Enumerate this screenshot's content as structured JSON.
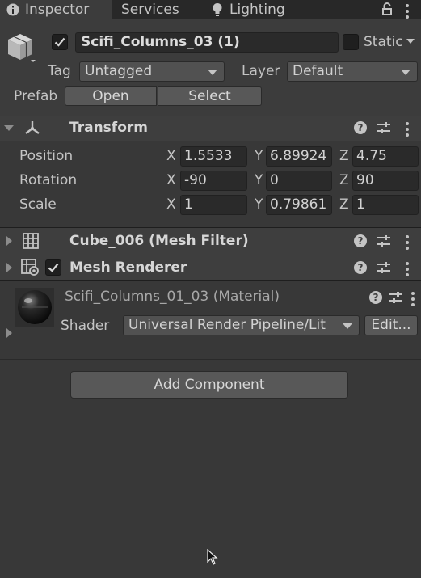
{
  "tabs": {
    "inspector": "Inspector",
    "services": "Services",
    "lighting": "Lighting"
  },
  "object": {
    "active": true,
    "name": "Scifi_Columns_03 (1)",
    "static_label": "Static",
    "static_checked": false,
    "tag_label": "Tag",
    "tag_value": "Untagged",
    "layer_label": "Layer",
    "layer_value": "Default",
    "prefab_label": "Prefab",
    "prefab_open": "Open",
    "prefab_select": "Select"
  },
  "transform": {
    "title": "Transform",
    "rows": [
      {
        "label": "Position",
        "x": "1.5533",
        "y": "6.89924",
        "z": "4.75"
      },
      {
        "label": "Rotation",
        "x": "-90",
        "y": "0",
        "z": "90"
      },
      {
        "label": "Scale",
        "x": "1",
        "y": "0.79861",
        "z": "1"
      }
    ],
    "axis_x": "X",
    "axis_y": "Y",
    "axis_z": "Z"
  },
  "mesh_filter": {
    "title": "Cube_006 (Mesh Filter)"
  },
  "mesh_renderer": {
    "title": "Mesh Renderer",
    "enabled": true
  },
  "material": {
    "title": "Scifi_Columns_01_03 (Material)",
    "shader_label": "Shader",
    "shader_value": "Universal Render Pipeline/Lit",
    "edit_label": "Edit..."
  },
  "add_component": "Add Component",
  "colors": {
    "background": "#383838",
    "header": "#3e3e3e",
    "tabbar": "#282828",
    "field": "#2a2a2a",
    "button": "#585858"
  }
}
